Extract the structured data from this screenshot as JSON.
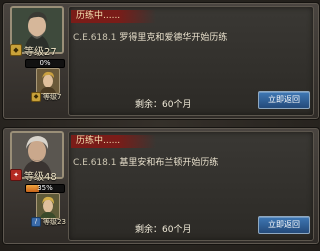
{
  "cards": [
    {
      "status": "历练中......",
      "date": "C.E.618.1",
      "message": "罗得里克和爱德华开始历练",
      "main_level": "等级27",
      "progress_text": "0%",
      "progress_pct": 0,
      "sub_level": "等级7",
      "remaining": "剩余：60个月",
      "return_label": "立即返回"
    },
    {
      "status": "历练中......",
      "date": "C.E.618.1",
      "message": "基里安和布兰顿开始历练",
      "main_level": "等级48",
      "progress_text": "35%",
      "progress_pct": 35,
      "sub_level": "等级23",
      "remaining": "剩余：60个月",
      "return_label": "立即返回"
    }
  ],
  "colors": {
    "tag_bg": "#7a1c18",
    "button_bg": "#3f78b5",
    "progress_fill": "#f1a640"
  },
  "icons": {
    "card1_class": "shield-icon",
    "card2_class": "axe-icon"
  }
}
